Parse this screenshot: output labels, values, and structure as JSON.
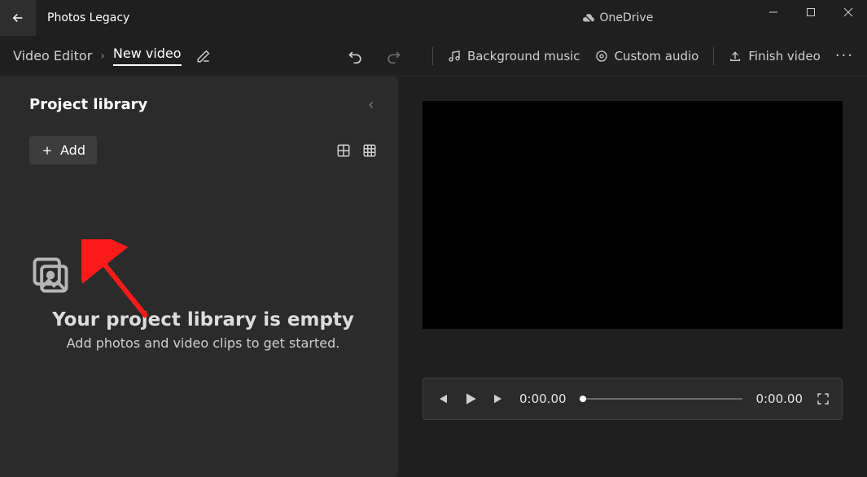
{
  "app": {
    "title": "Photos Legacy",
    "onedrive": "OneDrive"
  },
  "breadcrumb": {
    "root": "Video Editor",
    "current": "New video"
  },
  "toolbar": {
    "bg_music": "Background music",
    "custom_audio": "Custom audio",
    "finish": "Finish video"
  },
  "library": {
    "title": "Project library",
    "add_label": "Add",
    "empty_title": "Your project library is empty",
    "empty_sub": "Add photos and video clips to get started."
  },
  "player": {
    "time_current": "0:00.00",
    "time_total": "0:00.00"
  }
}
